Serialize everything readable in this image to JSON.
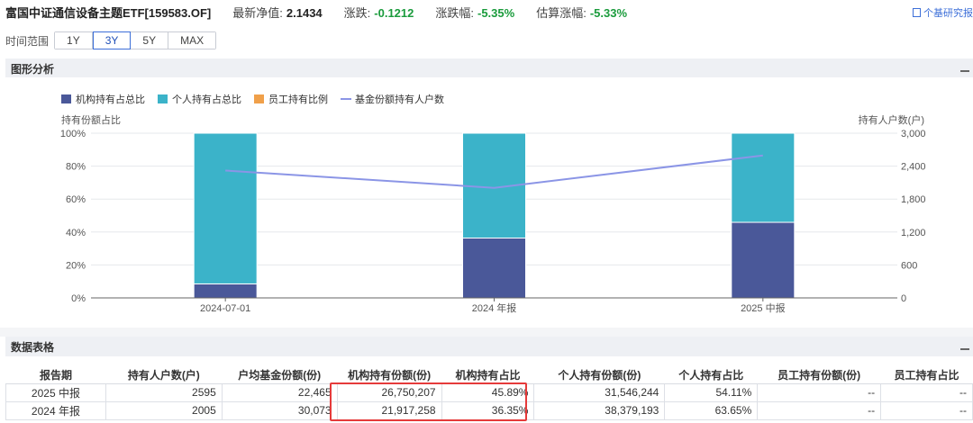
{
  "header": {
    "fund_name": "富国中证通信设备主题ETF[159583.OF]",
    "nav_label": "最新净值:",
    "nav_value": "2.1434",
    "change_label": "涨跌:",
    "change_value": "-0.1212",
    "change_pct_label": "涨跌幅:",
    "change_pct_value": "-5.35%",
    "est_label": "估算涨幅:",
    "est_value": "-5.33%",
    "report_link": "个基研究报",
    "colors": {
      "negative": "#1a9b3c",
      "link": "#3d6fd8"
    }
  },
  "time_range": {
    "label": "时间范围",
    "options": [
      "1Y",
      "3Y",
      "5Y",
      "MAX"
    ],
    "selected": "3Y"
  },
  "chart_section": {
    "title": "图形分析"
  },
  "chart_data": {
    "type": "bar",
    "stacked": true,
    "categories": [
      "2024-07-01",
      "2024 年报",
      "2025 中报"
    ],
    "series": [
      {
        "name": "机构持有占总比",
        "kind": "bar",
        "axis": "left",
        "color": "#4a5899",
        "values": [
          8.5,
          36.35,
          45.89
        ]
      },
      {
        "name": "个人持有占总比",
        "kind": "bar",
        "axis": "left",
        "color": "#3bb3c9",
        "values": [
          91.5,
          63.65,
          54.11
        ]
      },
      {
        "name": "员工持有比例",
        "kind": "bar",
        "axis": "left",
        "color": "#f0a04a",
        "values": [
          0,
          0,
          0
        ]
      },
      {
        "name": "基金份额持有人户数",
        "kind": "line",
        "axis": "right",
        "color": "#8b95e6",
        "values": [
          2320,
          2005,
          2595
        ]
      }
    ],
    "ylabel": "持有份额占比",
    "y2label": "持有人户数(户)",
    "ylim": [
      0,
      100
    ],
    "y_ticks": [
      "0%",
      "20%",
      "40%",
      "60%",
      "80%",
      "100%"
    ],
    "y2lim": [
      0,
      3000
    ],
    "y2_ticks": [
      "0",
      "600",
      "1,200",
      "1,800",
      "2,400",
      "3,000"
    ],
    "grid": true,
    "legend": "top-left"
  },
  "table_section": {
    "title": "数据表格"
  },
  "table": {
    "columns": [
      "报告期",
      "持有人户数(户)",
      "户均基金份额(份)",
      "机构持有份额(份)",
      "机构持有占比",
      "个人持有份额(份)",
      "个人持有占比",
      "员工持有份额(份)",
      "员工持有占比"
    ],
    "rows": [
      [
        "2025 中报",
        "2595",
        "22,465",
        "26,750,207",
        "45.89%",
        "31,546,244",
        "54.11%",
        "--",
        "--"
      ],
      [
        "2024 年报",
        "2005",
        "30,073",
        "21,917,258",
        "36.35%",
        "38,379,193",
        "63.65%",
        "--",
        "--"
      ]
    ]
  }
}
